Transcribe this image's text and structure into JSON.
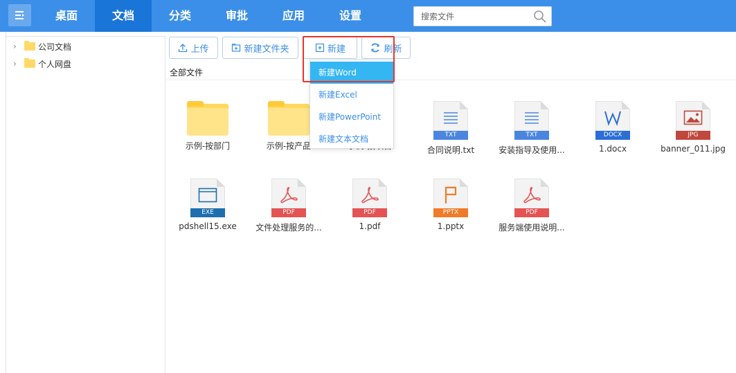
{
  "topbar": {
    "nav": [
      {
        "label": "桌面",
        "active": false
      },
      {
        "label": "文档",
        "active": true
      },
      {
        "label": "分类",
        "active": false
      },
      {
        "label": "审批",
        "active": false
      },
      {
        "label": "应用",
        "active": false
      },
      {
        "label": "设置",
        "active": false
      }
    ],
    "search_placeholder": "搜索文件"
  },
  "sidebar": {
    "items": [
      {
        "label": "公司文档"
      },
      {
        "label": "个人网盘"
      }
    ]
  },
  "toolbar": {
    "upload": "上传",
    "new_folder": "新建文件夹",
    "new": "新建",
    "refresh": "刷新"
  },
  "breadcrumb": "全部文件",
  "dropdown": {
    "items": [
      "新建Word",
      "新建Excel",
      "新建PowerPoint",
      "新建文本文档"
    ],
    "active_index": 0
  },
  "files": [
    {
      "name": "示例-按部门",
      "type": "folder"
    },
    {
      "name": "示例-按产品",
      "type": "folder"
    },
    {
      "name": "示例-按项目",
      "type": "folder"
    },
    {
      "name": "合同说明.txt",
      "type": "TXT"
    },
    {
      "name": "安装指导及使用...",
      "type": "TXT"
    },
    {
      "name": "1.docx",
      "type": "DOCX"
    },
    {
      "name": "banner_011.jpg",
      "type": "JPG"
    },
    {
      "name": "pdshell15.exe",
      "type": "EXE"
    },
    {
      "name": "文件处理服务的...",
      "type": "PDF"
    },
    {
      "name": "1.pdf",
      "type": "PDF"
    },
    {
      "name": "1.pptx",
      "type": "PPTX"
    },
    {
      "name": "服务端使用说明...",
      "type": "PDF"
    }
  ],
  "colors": {
    "topbar": "#3b8fe8",
    "nav_active": "#1a75d8",
    "accent": "#3b8fe8",
    "txt_band": "#4a86e0",
    "docx_band": "#2a6ed6",
    "jpg_band": "#c0483d",
    "exe_band": "#1d6fb0",
    "pdf_band": "#e45454",
    "pptx_band": "#f07c2a",
    "highlight": "#e8342d",
    "dropdown_active": "#34b6f3"
  }
}
